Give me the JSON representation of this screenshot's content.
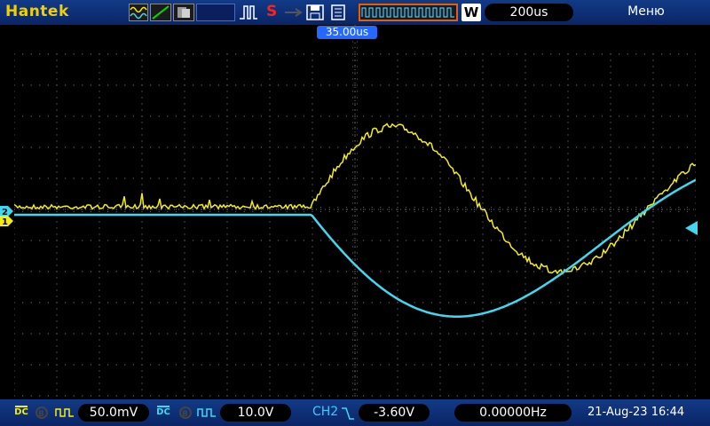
{
  "topbar": {
    "brand": "Hantek",
    "timebase": "200us",
    "menu": "Меню",
    "w_label": "W",
    "s_label": "S"
  },
  "screen": {
    "trigger_position": "35.00us",
    "ch1_marker": "1",
    "ch2_marker": "2"
  },
  "bottombar": {
    "ch1_coupling": "DC",
    "ch1_volts_div": "50.0mV",
    "ch2_coupling": "DC",
    "ch2_volts_div": "10.0V",
    "trigger_source": "CH2",
    "trigger_level": "-3.60V",
    "frequency": "0.00000Hz",
    "datetime": "21-Aug-23 16:44"
  },
  "colors": {
    "ch1": "#f5ec10",
    "ch2": "#40d8f0",
    "bar": "#0a2566",
    "trigger_marker": "#2468ff"
  },
  "icons": [
    "waveform-icon",
    "ramp-icon",
    "recorder-icon",
    "pulse-icon",
    "usb-icon",
    "save-icon",
    "measure-icon",
    "hscroll-icon"
  ]
}
